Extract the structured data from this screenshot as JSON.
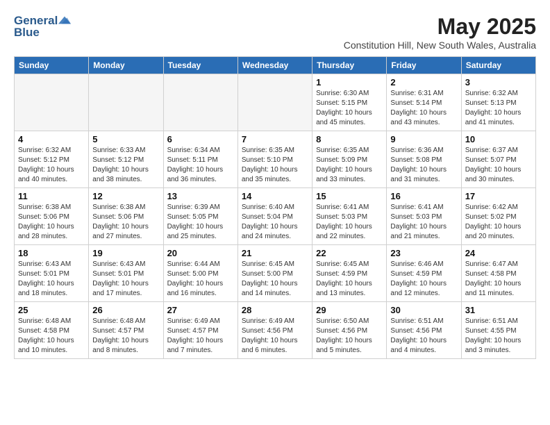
{
  "logo": {
    "line1": "General",
    "line2": "Blue"
  },
  "title": "May 2025",
  "location": "Constitution Hill, New South Wales, Australia",
  "weekdays": [
    "Sunday",
    "Monday",
    "Tuesday",
    "Wednesday",
    "Thursday",
    "Friday",
    "Saturday"
  ],
  "weeks": [
    [
      {
        "day": "",
        "sunrise": "",
        "sunset": "",
        "daylight": ""
      },
      {
        "day": "",
        "sunrise": "",
        "sunset": "",
        "daylight": ""
      },
      {
        "day": "",
        "sunrise": "",
        "sunset": "",
        "daylight": ""
      },
      {
        "day": "",
        "sunrise": "",
        "sunset": "",
        "daylight": ""
      },
      {
        "day": "1",
        "sunrise": "Sunrise: 6:30 AM",
        "sunset": "Sunset: 5:15 PM",
        "daylight": "Daylight: 10 hours and 45 minutes."
      },
      {
        "day": "2",
        "sunrise": "Sunrise: 6:31 AM",
        "sunset": "Sunset: 5:14 PM",
        "daylight": "Daylight: 10 hours and 43 minutes."
      },
      {
        "day": "3",
        "sunrise": "Sunrise: 6:32 AM",
        "sunset": "Sunset: 5:13 PM",
        "daylight": "Daylight: 10 hours and 41 minutes."
      }
    ],
    [
      {
        "day": "4",
        "sunrise": "Sunrise: 6:32 AM",
        "sunset": "Sunset: 5:12 PM",
        "daylight": "Daylight: 10 hours and 40 minutes."
      },
      {
        "day": "5",
        "sunrise": "Sunrise: 6:33 AM",
        "sunset": "Sunset: 5:12 PM",
        "daylight": "Daylight: 10 hours and 38 minutes."
      },
      {
        "day": "6",
        "sunrise": "Sunrise: 6:34 AM",
        "sunset": "Sunset: 5:11 PM",
        "daylight": "Daylight: 10 hours and 36 minutes."
      },
      {
        "day": "7",
        "sunrise": "Sunrise: 6:35 AM",
        "sunset": "Sunset: 5:10 PM",
        "daylight": "Daylight: 10 hours and 35 minutes."
      },
      {
        "day": "8",
        "sunrise": "Sunrise: 6:35 AM",
        "sunset": "Sunset: 5:09 PM",
        "daylight": "Daylight: 10 hours and 33 minutes."
      },
      {
        "day": "9",
        "sunrise": "Sunrise: 6:36 AM",
        "sunset": "Sunset: 5:08 PM",
        "daylight": "Daylight: 10 hours and 31 minutes."
      },
      {
        "day": "10",
        "sunrise": "Sunrise: 6:37 AM",
        "sunset": "Sunset: 5:07 PM",
        "daylight": "Daylight: 10 hours and 30 minutes."
      }
    ],
    [
      {
        "day": "11",
        "sunrise": "Sunrise: 6:38 AM",
        "sunset": "Sunset: 5:06 PM",
        "daylight": "Daylight: 10 hours and 28 minutes."
      },
      {
        "day": "12",
        "sunrise": "Sunrise: 6:38 AM",
        "sunset": "Sunset: 5:06 PM",
        "daylight": "Daylight: 10 hours and 27 minutes."
      },
      {
        "day": "13",
        "sunrise": "Sunrise: 6:39 AM",
        "sunset": "Sunset: 5:05 PM",
        "daylight": "Daylight: 10 hours and 25 minutes."
      },
      {
        "day": "14",
        "sunrise": "Sunrise: 6:40 AM",
        "sunset": "Sunset: 5:04 PM",
        "daylight": "Daylight: 10 hours and 24 minutes."
      },
      {
        "day": "15",
        "sunrise": "Sunrise: 6:41 AM",
        "sunset": "Sunset: 5:03 PM",
        "daylight": "Daylight: 10 hours and 22 minutes."
      },
      {
        "day": "16",
        "sunrise": "Sunrise: 6:41 AM",
        "sunset": "Sunset: 5:03 PM",
        "daylight": "Daylight: 10 hours and 21 minutes."
      },
      {
        "day": "17",
        "sunrise": "Sunrise: 6:42 AM",
        "sunset": "Sunset: 5:02 PM",
        "daylight": "Daylight: 10 hours and 20 minutes."
      }
    ],
    [
      {
        "day": "18",
        "sunrise": "Sunrise: 6:43 AM",
        "sunset": "Sunset: 5:01 PM",
        "daylight": "Daylight: 10 hours and 18 minutes."
      },
      {
        "day": "19",
        "sunrise": "Sunrise: 6:43 AM",
        "sunset": "Sunset: 5:01 PM",
        "daylight": "Daylight: 10 hours and 17 minutes."
      },
      {
        "day": "20",
        "sunrise": "Sunrise: 6:44 AM",
        "sunset": "Sunset: 5:00 PM",
        "daylight": "Daylight: 10 hours and 16 minutes."
      },
      {
        "day": "21",
        "sunrise": "Sunrise: 6:45 AM",
        "sunset": "Sunset: 5:00 PM",
        "daylight": "Daylight: 10 hours and 14 minutes."
      },
      {
        "day": "22",
        "sunrise": "Sunrise: 6:45 AM",
        "sunset": "Sunset: 4:59 PM",
        "daylight": "Daylight: 10 hours and 13 minutes."
      },
      {
        "day": "23",
        "sunrise": "Sunrise: 6:46 AM",
        "sunset": "Sunset: 4:59 PM",
        "daylight": "Daylight: 10 hours and 12 minutes."
      },
      {
        "day": "24",
        "sunrise": "Sunrise: 6:47 AM",
        "sunset": "Sunset: 4:58 PM",
        "daylight": "Daylight: 10 hours and 11 minutes."
      }
    ],
    [
      {
        "day": "25",
        "sunrise": "Sunrise: 6:48 AM",
        "sunset": "Sunset: 4:58 PM",
        "daylight": "Daylight: 10 hours and 10 minutes."
      },
      {
        "day": "26",
        "sunrise": "Sunrise: 6:48 AM",
        "sunset": "Sunset: 4:57 PM",
        "daylight": "Daylight: 10 hours and 8 minutes."
      },
      {
        "day": "27",
        "sunrise": "Sunrise: 6:49 AM",
        "sunset": "Sunset: 4:57 PM",
        "daylight": "Daylight: 10 hours and 7 minutes."
      },
      {
        "day": "28",
        "sunrise": "Sunrise: 6:49 AM",
        "sunset": "Sunset: 4:56 PM",
        "daylight": "Daylight: 10 hours and 6 minutes."
      },
      {
        "day": "29",
        "sunrise": "Sunrise: 6:50 AM",
        "sunset": "Sunset: 4:56 PM",
        "daylight": "Daylight: 10 hours and 5 minutes."
      },
      {
        "day": "30",
        "sunrise": "Sunrise: 6:51 AM",
        "sunset": "Sunset: 4:56 PM",
        "daylight": "Daylight: 10 hours and 4 minutes."
      },
      {
        "day": "31",
        "sunrise": "Sunrise: 6:51 AM",
        "sunset": "Sunset: 4:55 PM",
        "daylight": "Daylight: 10 hours and 3 minutes."
      }
    ]
  ]
}
